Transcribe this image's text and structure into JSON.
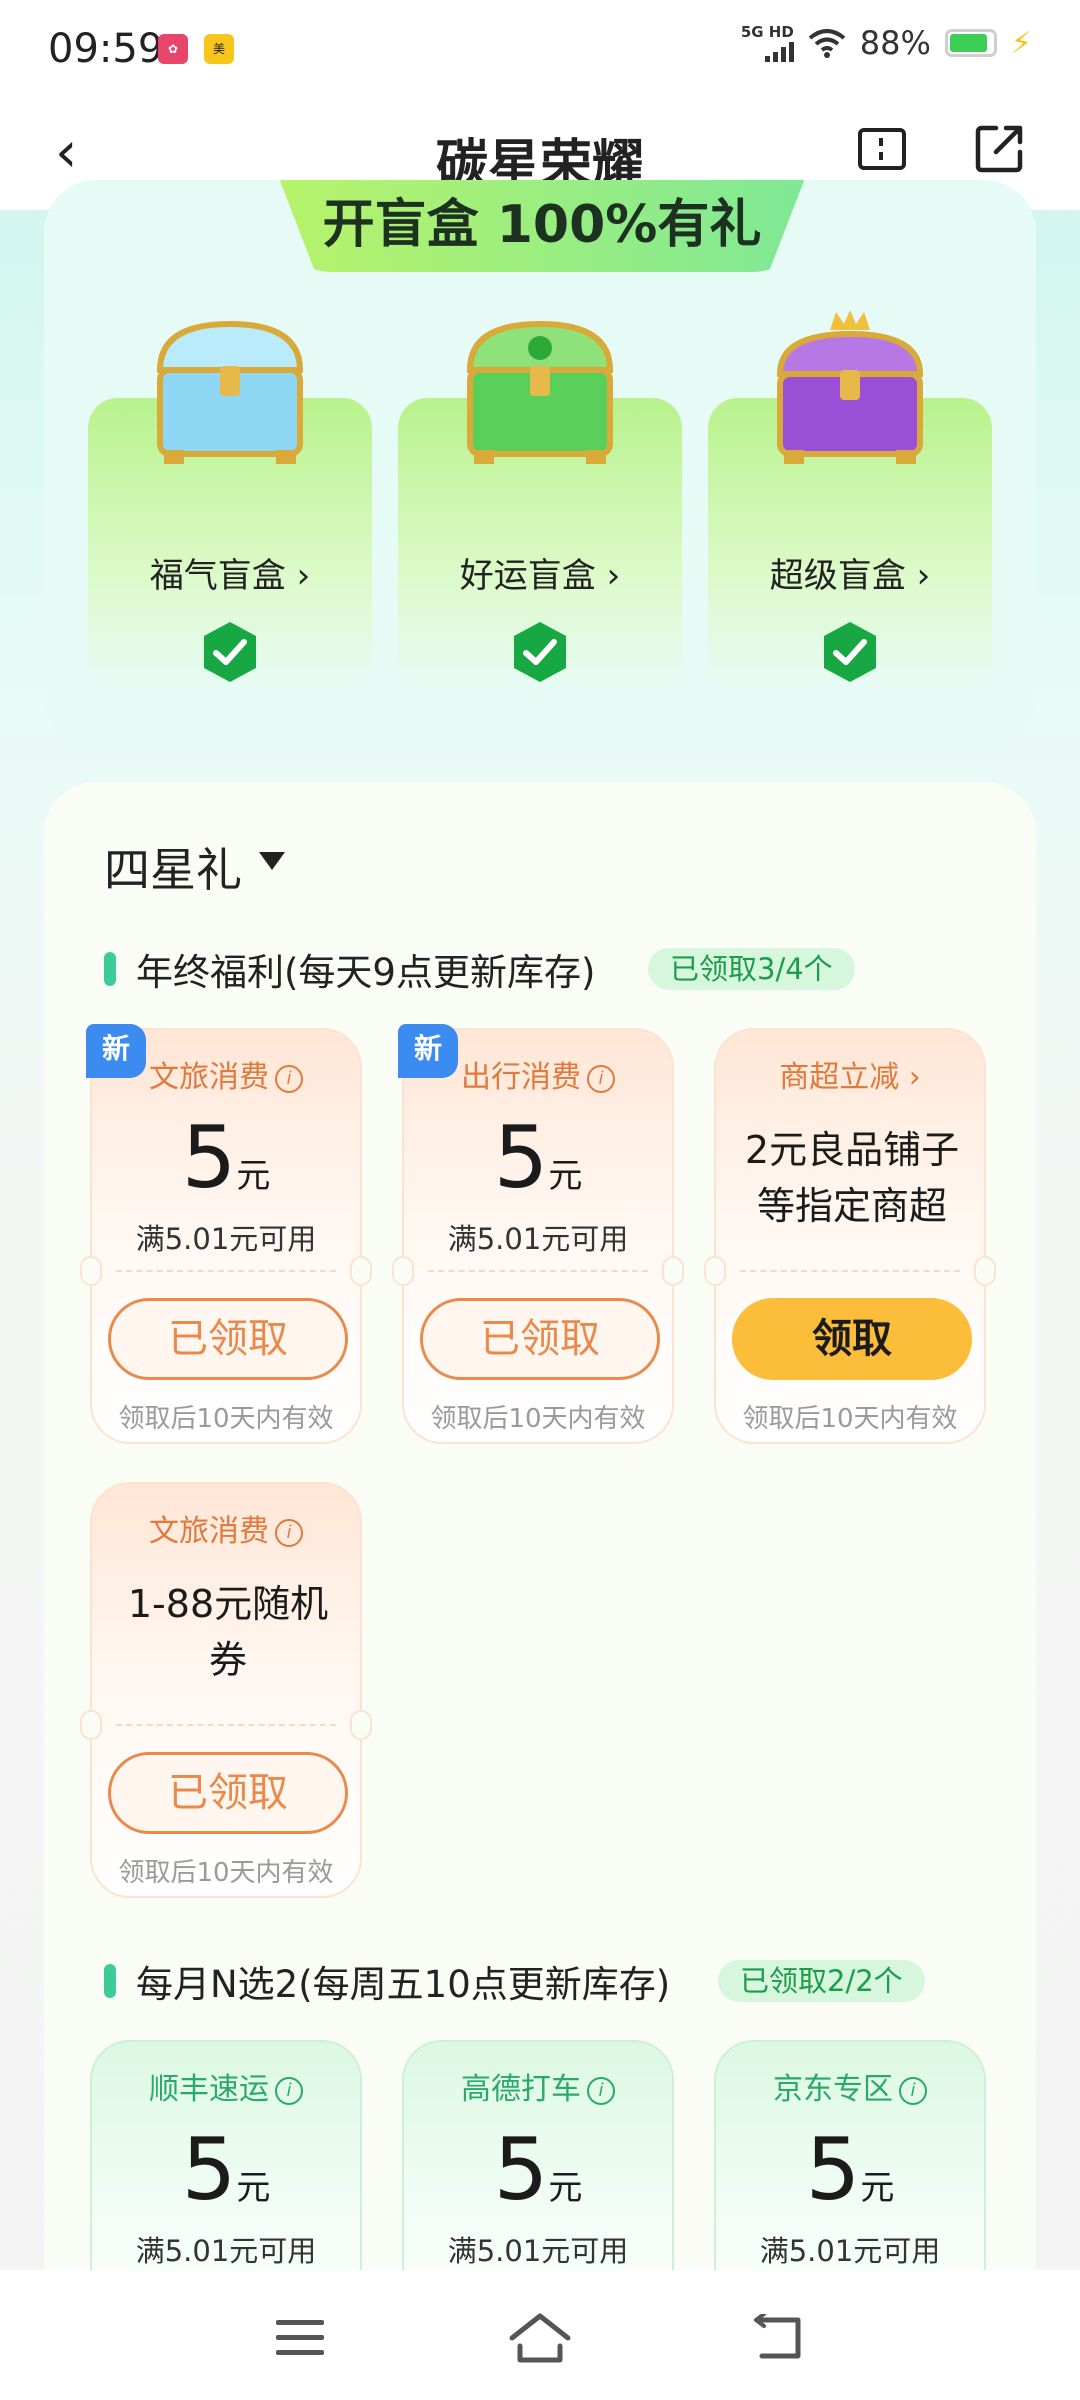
{
  "status_bar": {
    "time": "09:59",
    "network": "5G HD",
    "battery": "88%"
  },
  "nav": {
    "title": "碳星荣耀"
  },
  "blind_box": {
    "banner": "开盲盒 100%有礼",
    "boxes": [
      {
        "label": "福气盲盒",
        "arrow": "›",
        "color": "#8fd8f5"
      },
      {
        "label": "好运盲盒",
        "arrow": "›",
        "color": "#5ad05a"
      },
      {
        "label": "超级盲盒",
        "arrow": "›",
        "color": "#9b4fd6"
      }
    ]
  },
  "main": {
    "tier_title": "四星礼",
    "section1": {
      "title": "年终福利(每天9点更新库存)",
      "badge": "已领取3/4个",
      "coupons": [
        {
          "new_tag": "新",
          "head": "文旅消费",
          "amount": "5",
          "unit": "元",
          "cond": "满5.01元可用",
          "button": "已领取",
          "valid": "领取后10天内有效"
        },
        {
          "new_tag": "新",
          "head": "出行消费",
          "amount": "5",
          "unit": "元",
          "cond": "满5.01元可用",
          "button": "已领取",
          "valid": "领取后10天内有效"
        },
        {
          "head": "商超立减",
          "arrow": "›",
          "desc": "2元良品铺子等指定商超",
          "button": "领取",
          "valid": "领取后10天内有效"
        },
        {
          "head": "文旅消费",
          "desc": "1-88元随机券",
          "button": "已领取",
          "valid": "领取后10天内有效"
        }
      ]
    },
    "section2": {
      "title": "每月N选2(每周五10点更新库存)",
      "badge": "已领取2/2个",
      "coupons": [
        {
          "head": "顺丰速运",
          "amount": "5",
          "unit": "元",
          "cond": "满5.01元可用"
        },
        {
          "head": "高德打车",
          "amount": "5",
          "unit": "元",
          "cond": "满5.01元可用"
        },
        {
          "head": "京东专区",
          "amount": "5",
          "unit": "元",
          "cond": "满5.01元可用"
        }
      ]
    }
  },
  "icons": {
    "info": "i",
    "back": "‹"
  }
}
